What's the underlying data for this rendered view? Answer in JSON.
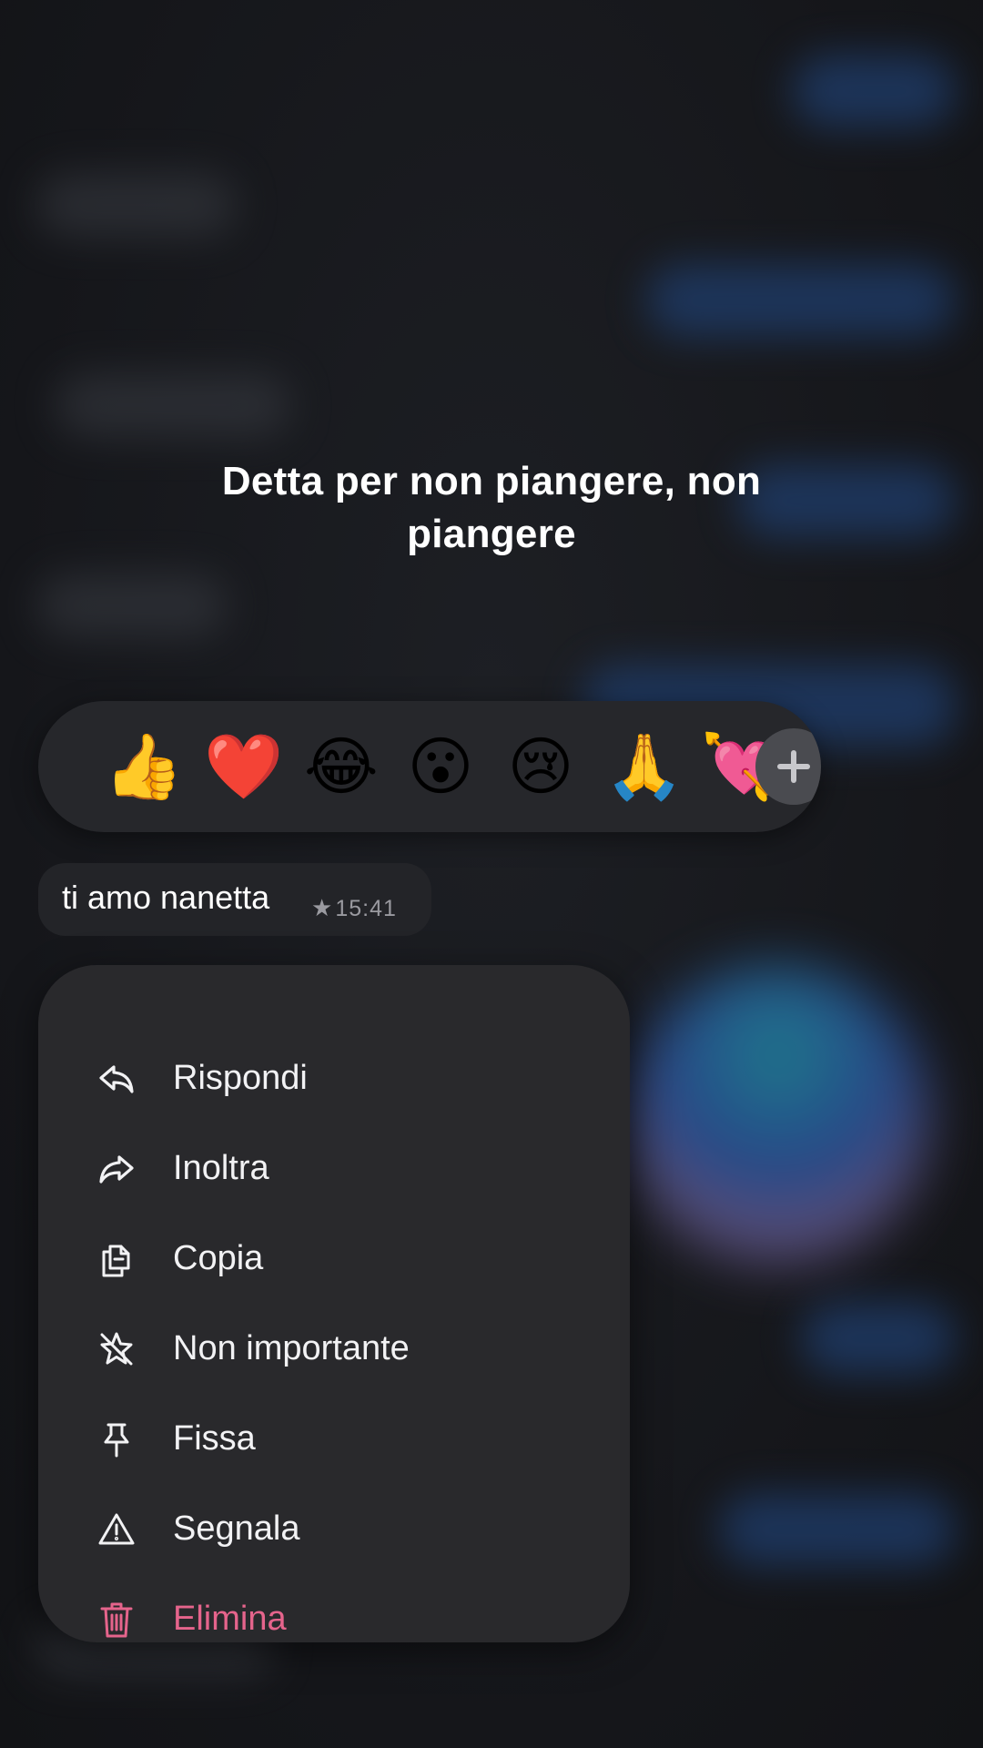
{
  "song_title": "Detta per non piangere, non piangere",
  "reactions": {
    "emojis": [
      {
        "glyph": "👍",
        "name": "thumbs-up"
      },
      {
        "glyph": "❤️",
        "name": "red-heart"
      },
      {
        "glyph": "😂",
        "name": "tears-of-joy"
      },
      {
        "glyph": "😮",
        "name": "open-mouth"
      },
      {
        "glyph": "😢",
        "name": "crying-face"
      },
      {
        "glyph": "🙏",
        "name": "folded-hands"
      },
      {
        "glyph": "💘",
        "name": "heart-with-arrow"
      }
    ],
    "plus_icon": "plus-icon"
  },
  "message": {
    "text": "ti amo nanetta",
    "star": "★",
    "time": "15:41"
  },
  "menu": {
    "items": [
      {
        "label": "Rispondi",
        "icon": "reply-icon"
      },
      {
        "label": "Inoltra",
        "icon": "forward-icon"
      },
      {
        "label": "Copia",
        "icon": "copy-icon"
      },
      {
        "label": "Non importante",
        "icon": "unstar-icon"
      },
      {
        "label": "Fissa",
        "icon": "pin-icon"
      },
      {
        "label": "Segnala",
        "icon": "warning-icon"
      },
      {
        "label": "Elimina",
        "icon": "trash-icon",
        "danger": true
      }
    ]
  },
  "colors": {
    "danger": "#e5648c",
    "menu_bg": "#29292c",
    "accent_bubble": "#1f3e6e"
  }
}
